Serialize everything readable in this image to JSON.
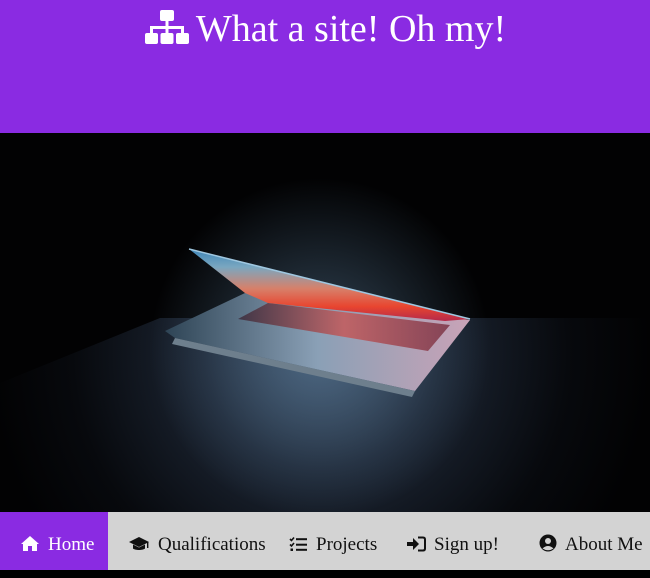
{
  "header": {
    "title": "What a site! Oh my!",
    "icon": "sitemap-icon",
    "background": "#8a2be2"
  },
  "hero": {
    "image": "laptop-in-dark-photo"
  },
  "nav": {
    "background": "#d3d3d3",
    "active_background": "#8a2be2",
    "items": [
      {
        "label": "Home",
        "icon": "home-icon",
        "active": true
      },
      {
        "label": "Qualifications",
        "icon": "graduation-cap-icon",
        "active": false
      },
      {
        "label": "Projects",
        "icon": "tasks-icon",
        "active": false
      },
      {
        "label": "Sign up!",
        "icon": "sign-in-icon",
        "active": false
      },
      {
        "label": "About Me",
        "icon": "user-circle-icon",
        "active": false
      }
    ]
  }
}
